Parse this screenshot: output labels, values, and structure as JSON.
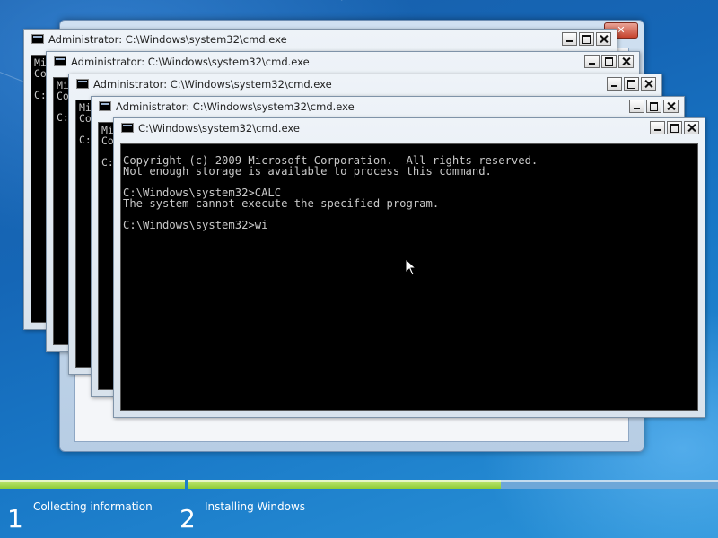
{
  "windows": {
    "back1": {
      "title": "Administrator: C:\\Windows\\system32\\cmd.exe",
      "console": "Mi\nCo\n\nC:"
    },
    "back2": {
      "title": "Administrator: C:\\Windows\\system32\\cmd.exe",
      "console": "Mi\nCo\n\nC:"
    },
    "back3": {
      "title": "Administrator: C:\\Windows\\system32\\cmd.exe",
      "console": "Mi\nCo\n\nC:"
    },
    "back4": {
      "title": "Administrator: C:\\Windows\\system32\\cmd.exe",
      "console": "Mi\nCo\n\nC:"
    },
    "front": {
      "title": "C:\\Windows\\system32\\cmd.exe",
      "console": "Copyright (c) 2009 Microsoft Corporation.  All rights reserved.\nNot enough storage is available to process this command.\n\nC:\\Windows\\system32>CALC\nThe system cannot execute the specified program.\n\nC:\\Windows\\system32>wi"
    }
  },
  "progress": {
    "step1": {
      "number": "1",
      "label": "Collecting information",
      "fill": 1.0
    },
    "step2": {
      "number": "2",
      "label": "Installing Windows",
      "fill": 0.59
    }
  },
  "colors": {
    "progress_fill": "#8dcb36",
    "console_bg": "#000000",
    "console_text": "#c8c8c8"
  }
}
